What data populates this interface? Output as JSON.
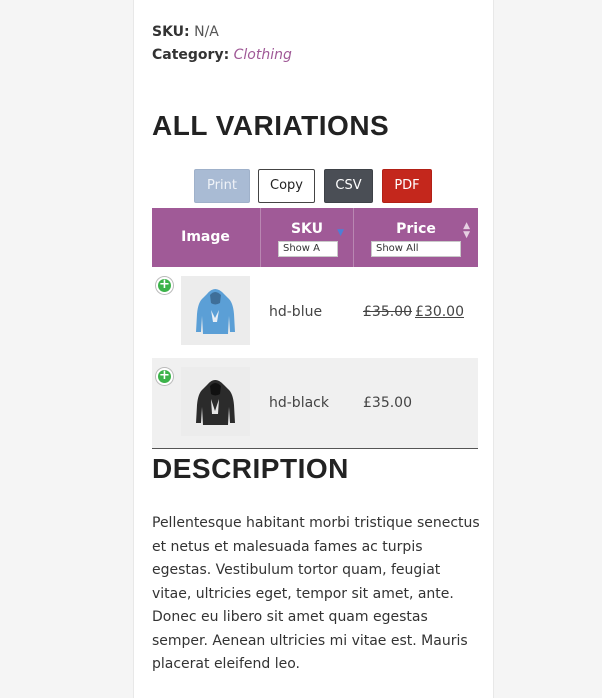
{
  "product_meta": {
    "sku_label": "SKU:",
    "sku_value": "N/A",
    "category_label": "Category:",
    "category_value": "Clothing"
  },
  "variations": {
    "heading": "ALL VARIATIONS",
    "buttons": {
      "print": "Print",
      "copy": "Copy",
      "csv": "CSV",
      "pdf": "PDF"
    },
    "columns": {
      "image": "Image",
      "sku": "SKU",
      "price": "Price",
      "sku_filter": "Show A",
      "price_filter": "Show All"
    },
    "rows": [
      {
        "sku": "hd-blue",
        "price_old": "£35.00",
        "price_new": "£30.00",
        "image_icon": "blue-hoodie-image",
        "hoodie_color": "#5b9fd6"
      },
      {
        "sku": "hd-black",
        "price": "£35.00",
        "image_icon": "black-hoodie-image",
        "hoodie_color": "#2b2b2b"
      }
    ]
  },
  "description": {
    "heading": "DESCRIPTION",
    "text": "Pellentesque habitant morbi tristique senectus et netus et malesuada fames ac turpis egestas. Vestibulum tortor quam, feugiat vitae, ultricies eget, tempor sit amet, ante. Donec eu libero sit amet quam egestas semper. Aenean ultricies mi vitae est. Mauris placerat eleifend leo."
  },
  "colors": {
    "accent": "#a05a97",
    "print_button": "#a9bbd4",
    "csv_button": "#4a4e55",
    "pdf_button": "#c4271c",
    "expand_button": "#3cb34a"
  }
}
